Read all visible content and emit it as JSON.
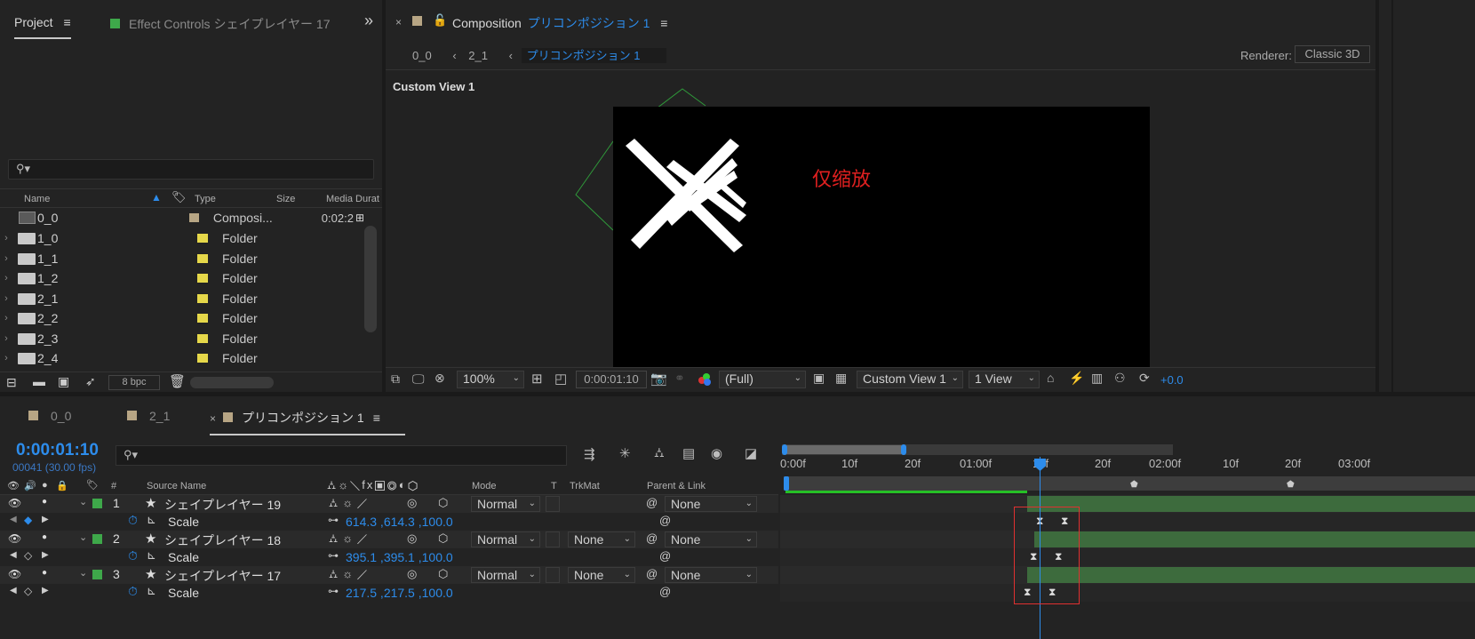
{
  "project_panel": {
    "tab_project": "Project",
    "tab_effect_controls": "Effect Controls シェイプレイヤー 17",
    "search_placeholder": "",
    "columns": {
      "name": "Name",
      "type": "Type",
      "size": "Size",
      "media_duration": "Media Durat"
    },
    "items": [
      {
        "name": "0_0",
        "type": "Composi...",
        "duration": "0:02:2",
        "kind": "comp",
        "color": "#b7a584"
      },
      {
        "name": "1_0",
        "type": "Folder",
        "kind": "folder",
        "color": "#e6d84a"
      },
      {
        "name": "1_1",
        "type": "Folder",
        "kind": "folder",
        "color": "#e6d84a"
      },
      {
        "name": "1_2",
        "type": "Folder",
        "kind": "folder",
        "color": "#e6d84a"
      },
      {
        "name": "2_1",
        "type": "Folder",
        "kind": "folder",
        "color": "#e6d84a"
      },
      {
        "name": "2_2",
        "type": "Folder",
        "kind": "folder",
        "color": "#e6d84a"
      },
      {
        "name": "2_3",
        "type": "Folder",
        "kind": "folder",
        "color": "#e6d84a"
      },
      {
        "name": "2_4",
        "type": "Folder",
        "kind": "folder",
        "color": "#e6d84a"
      }
    ],
    "bpc": "8 bpc"
  },
  "composition_panel": {
    "tab_prefix": "Composition",
    "tab_comp_name": "プリコンポジション 1",
    "breadcrumbs": [
      "0_0",
      "2_1",
      "プリコンポジション 1"
    ],
    "renderer_label": "Renderer:",
    "renderer_value": "Classic 3D",
    "view_label": "Custom View 1",
    "annotation_text": "仅缩放",
    "annotation_color": "#e02020",
    "zoom": "100%",
    "timecode": "0:00:01:10",
    "resolution": "(Full)",
    "view_select": "Custom View 1",
    "view_count": "1 View",
    "exposure": "+0.0"
  },
  "timeline_panel": {
    "tabs": [
      {
        "label": "0_0",
        "color": "#b7a584"
      },
      {
        "label": "2_1",
        "color": "#b7a584"
      },
      {
        "label": "プリコンポジション 1",
        "color": "#b7a584",
        "active": true
      }
    ],
    "current_time": "0:00:01:10",
    "frame_info": "00041 (30.00 fps)",
    "search_placeholder": "",
    "columns": {
      "num": "#",
      "source_name": "Source Name",
      "mode": "Mode",
      "t": "T",
      "trkmat": "TrkMat",
      "parent": "Parent & Link"
    },
    "layers": [
      {
        "num": "1",
        "name": "シェイプレイヤー 19",
        "mode": "Normal",
        "trkmat": "",
        "parent": "None",
        "prop": "Scale",
        "value": "614.3 ,614.3 ,100.0"
      },
      {
        "num": "2",
        "name": "シェイプレイヤー 18",
        "mode": "Normal",
        "trkmat": "None",
        "parent": "None",
        "prop": "Scale",
        "value": "395.1 ,395.1 ,100.0"
      },
      {
        "num": "3",
        "name": "シェイプレイヤー 17",
        "mode": "Normal",
        "trkmat": "None",
        "parent": "None",
        "prop": "Scale",
        "value": "217.5 ,217.5 ,100.0"
      }
    ],
    "ruler_labels": [
      "0:00f",
      "10f",
      "20f",
      "01:00f",
      "10f",
      "20f",
      "02:00f",
      "10f",
      "20f",
      "03:00f"
    ],
    "accent_color": "#2d8ceb",
    "layer_bar_color": "#3d6b3d",
    "highlight_color": "#e03030"
  }
}
